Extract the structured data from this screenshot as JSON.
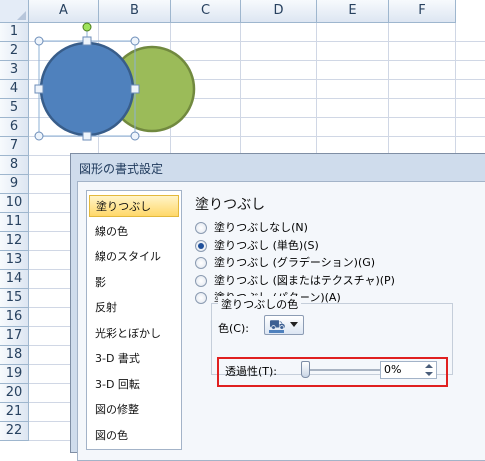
{
  "sheet": {
    "columns": [
      "A",
      "B",
      "C",
      "D",
      "E",
      "F"
    ],
    "rows": [
      "1",
      "2",
      "3",
      "4",
      "5",
      "6",
      "7",
      "8",
      "9",
      "10",
      "11",
      "12",
      "13",
      "14",
      "15",
      "16",
      "17",
      "18",
      "19",
      "20",
      "21",
      "22"
    ]
  },
  "shapes": {
    "circle_front_color": "#4f81bd",
    "circle_back_color": "#9bbb59"
  },
  "dialog": {
    "title": "図形の書式設定",
    "categories": [
      "塗りつぶし",
      "線の色",
      "線のスタイル",
      "影",
      "反射",
      "光彩とぼかし",
      "3-D 書式",
      "3-D 回転",
      "図の修整",
      "図の色"
    ],
    "selected_category": "塗りつぶし",
    "section_title": "塗りつぶし",
    "fill_options": [
      "塗りつぶしなし(N)",
      "塗りつぶし (単色)(S)",
      "塗りつぶし (グラデーション)(G)",
      "塗りつぶし (図またはテクスチャ)(P)",
      "塗りつぶし (パターン)(A)"
    ],
    "selected_fill": "塗りつぶし (単色)(S)",
    "color_group_label": "塗りつぶしの色",
    "color_label": "色(C):",
    "transparency_label": "透過性(T):",
    "transparency_value": "0%",
    "transparency_fraction": 0
  }
}
